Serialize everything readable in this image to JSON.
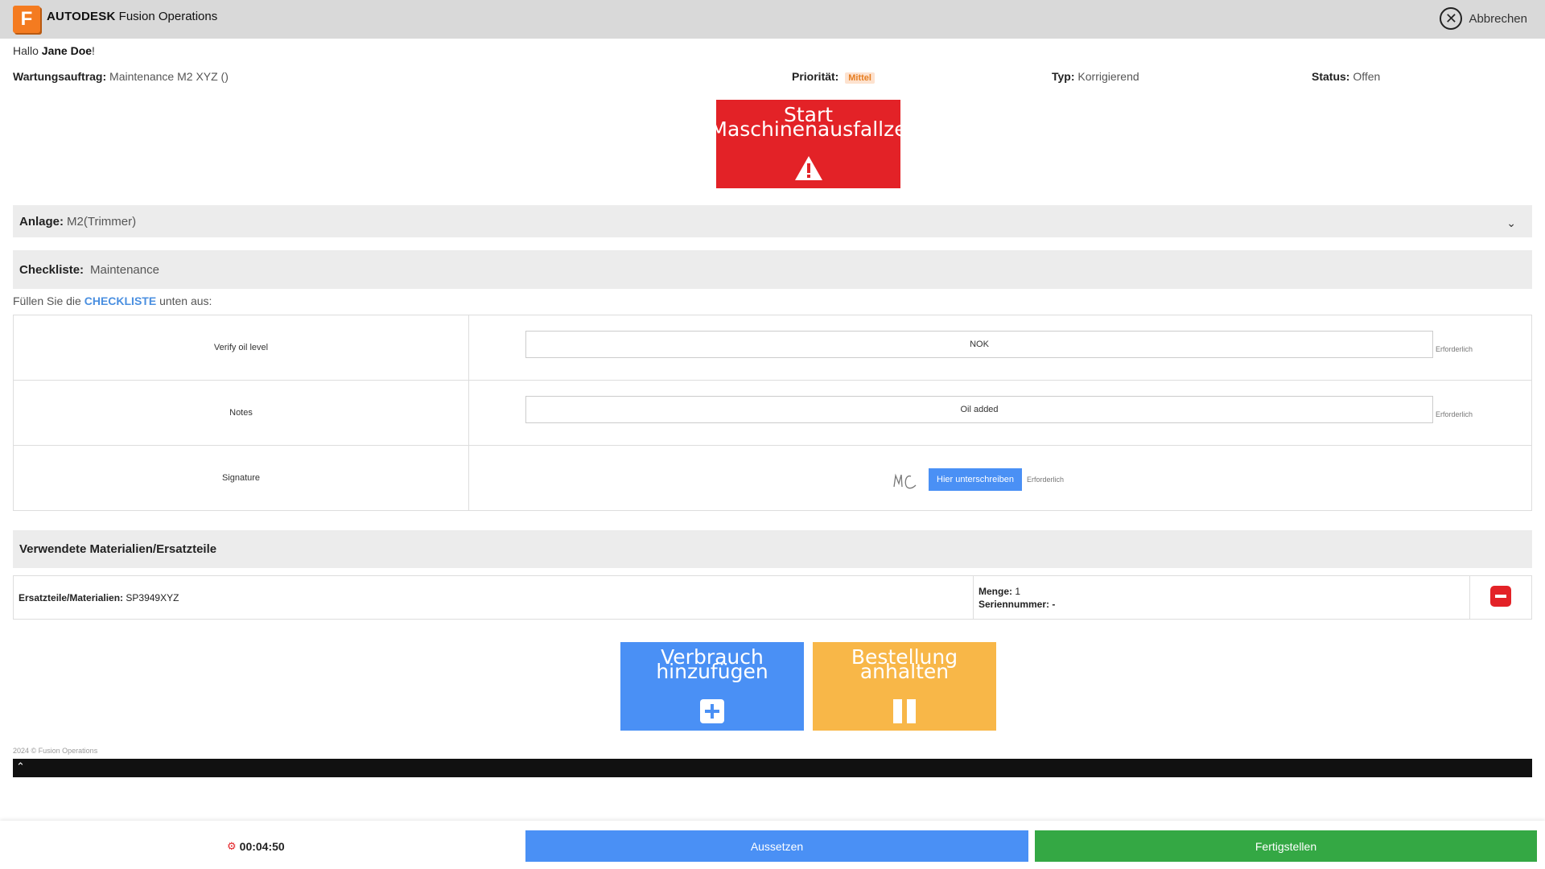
{
  "header": {
    "logo_letter": "F",
    "brand_bold": "AUTODESK",
    "brand_rest": "Fusion Operations",
    "cancel_label": "Abbrechen"
  },
  "greeting": {
    "prefix": "Hallo",
    "user": "Jane Doe",
    "suffix": "!"
  },
  "order": {
    "label": "Wartungsauftrag:",
    "value": "Maintenance M2 XYZ ()",
    "priority_label": "Priorität:",
    "priority_value": "Mittel",
    "type_label": "Typ:",
    "type_value": "Korrigierend",
    "status_label": "Status:",
    "status_value": "Offen"
  },
  "breakdown_button": {
    "line1": "Start",
    "line2": "Maschinenausfallze",
    "icon": "warning-icon"
  },
  "asset": {
    "label": "Anlage:",
    "value": "M2(Trimmer)"
  },
  "checklist": {
    "label": "Checkliste:",
    "value": "Maintenance",
    "instruction_prefix": "Füllen Sie die",
    "instruction_highlight": "CHECKLISTE",
    "instruction_suffix": "unten aus:",
    "items": [
      {
        "label": "Verify oil level",
        "value": "NOK",
        "required": "Erforderlich"
      },
      {
        "label": "Notes",
        "value": "Oil added",
        "required": "Erforderlich"
      },
      {
        "label": "Signature",
        "button": "Hier unterschreiben",
        "required": "Erforderlich"
      }
    ]
  },
  "materials": {
    "title": "Verwendete Materialien/Ersatzteile",
    "part_label": "Ersatzteile/Materialien:",
    "part_value": "SP3949XYZ",
    "qty_label": "Menge:",
    "qty_value": "1",
    "serial_label": "Seriennummer:",
    "serial_value": "-"
  },
  "actions": {
    "add_line1": "Verbrauch",
    "add_line2": "hinzufügen",
    "hold_line1": "Bestellung",
    "hold_line2": "anhalten"
  },
  "copyright": "2024 © Fusion Operations",
  "footer": {
    "timer": "00:04:50",
    "pause_label": "Aussetzen",
    "finish_label": "Fertigstellen"
  },
  "colors": {
    "brand_orange": "#f47b20",
    "danger_red": "#e32227",
    "primary_blue": "#4a90f5",
    "hold_orange": "#f8b748",
    "success_green": "#34a844"
  }
}
